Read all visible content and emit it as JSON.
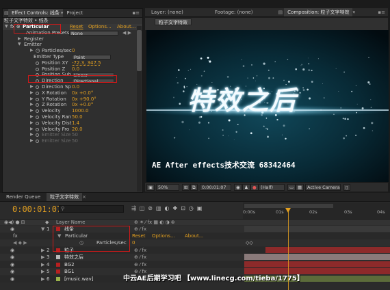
{
  "effect_controls": {
    "tab_label": "Effect Controls: 线条",
    "project_tab": "Project",
    "breadcrumb": "粒子文字特效 • 线条",
    "effect_name": "Particular",
    "reset": "Reset",
    "options": "Options...",
    "about": "About...",
    "animation_presets_label": "Animation Presets:",
    "animation_presets_value": "None",
    "sections": {
      "register": "Register",
      "emitter": "Emitter"
    },
    "props": [
      {
        "name": "Particles/sec",
        "value": "0"
      },
      {
        "name": "Emitter Type",
        "value": "Point"
      },
      {
        "name": "Position XY",
        "value": "-72.3, 347.5"
      },
      {
        "name": "Position Z",
        "value": "0.0"
      },
      {
        "name": "Position Sub",
        "value": "Linear"
      },
      {
        "name": "Direction",
        "value": "Directional"
      },
      {
        "name": "Direction Sp",
        "value": "0.0"
      },
      {
        "name": "X Rotation",
        "value": "0x +0.0°"
      },
      {
        "name": "Y Rotation",
        "value": "0x +90.0°"
      },
      {
        "name": "Z Rotation",
        "value": "0x +0.0°"
      },
      {
        "name": "Velocity",
        "value": "1000.0"
      },
      {
        "name": "Velocity Ran",
        "value": "50.0"
      },
      {
        "name": "Velocity Dist",
        "value": "1.4"
      },
      {
        "name": "Velocity Fro",
        "value": "20.0"
      },
      {
        "name": "Emitter Size",
        "value": "50"
      },
      {
        "name": "Emitter Size",
        "value": "50"
      }
    ]
  },
  "top_tabs": {
    "layer": "Layer: (none)",
    "footage": "Footage: (none)",
    "composition": "Composition: 粒子文字特效"
  },
  "comp_subtab": "粒子文字特效",
  "viewer": {
    "title_text": "特效之后",
    "caption": "AE After effects技术交流 68342464"
  },
  "viewer_toolbar": {
    "zoom": "50%",
    "timecode": "0:00:01:07",
    "resolution": "(Half)",
    "camera": "Active Camera"
  },
  "timeline": {
    "render_queue_tab": "Render Queue",
    "comp_tab": "粒子文字特效",
    "timecode": "0:00:01:07",
    "search_placeholder": "",
    "header_layer_name": "Layer Name",
    "ruler": [
      "0:00s",
      "01s",
      "02s",
      "03s",
      "04s"
    ],
    "layers": [
      {
        "num": "1",
        "name": "线条",
        "color": "#b82020"
      },
      {
        "num": "",
        "name": "Particular",
        "reset": "Reset",
        "options": "Options...",
        "about": "About..."
      },
      {
        "num": "",
        "name": "Particles/sec",
        "value": "0"
      },
      {
        "num": "2",
        "name": "粒子",
        "color": "#b82020"
      },
      {
        "num": "3",
        "name": "特效之后",
        "color": "#b8b8b8"
      },
      {
        "num": "4",
        "name": "BG2",
        "color": "#b82020"
      },
      {
        "num": "5",
        "name": "BG1",
        "color": "#b82020"
      },
      {
        "num": "6",
        "name": "[music.wav]",
        "color": "#9ab24a"
      }
    ]
  },
  "watermark": "中云AE后期学习吧 【www.linecg.com/tieba/1775】",
  "colors": {
    "accent": "#e3a020",
    "highlight": "#d21919",
    "layer_bar": "#8d2a2a"
  }
}
